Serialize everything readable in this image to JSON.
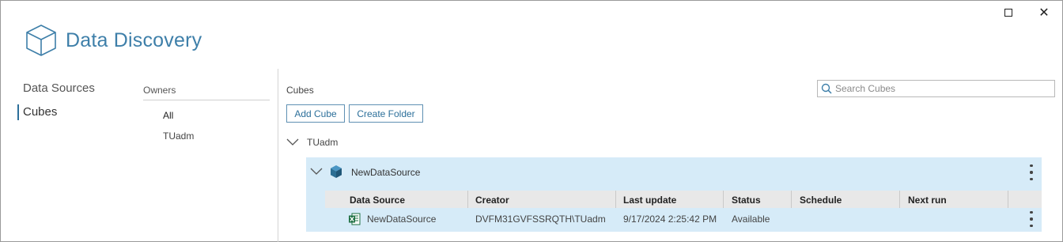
{
  "window": {
    "title": "Data Discovery",
    "controls": {
      "maximize": "maximize-icon",
      "close": "close-icon",
      "close_glyph": "✕"
    }
  },
  "nav": {
    "items": [
      {
        "label": "Data Sources",
        "selected": false
      },
      {
        "label": "Cubes",
        "selected": true
      }
    ]
  },
  "owners": {
    "title": "Owners",
    "items": [
      {
        "label": "All",
        "selected": true
      },
      {
        "label": "TUadm",
        "selected": false
      }
    ]
  },
  "cubes": {
    "title": "Cubes",
    "search_placeholder": "Search Cubes",
    "toolbar": {
      "add_label": "Add Cube",
      "folder_label": "Create Folder"
    },
    "folder": {
      "label": "TUadm",
      "expanded": true,
      "data_sources": [
        {
          "name": "NewDataSource",
          "expanded": true,
          "columns": [
            "Data Source",
            "Creator",
            "Last update",
            "Status",
            "Schedule",
            "Next run"
          ],
          "rows": [
            {
              "data_source": "NewDataSource",
              "creator": "DVFM31GVFSSRQTH\\TUadm",
              "last_update": "9/17/2024 2:25:42 PM",
              "status": "Available",
              "schedule": "",
              "next_run": ""
            }
          ]
        }
      ]
    }
  },
  "colors": {
    "accent": "#3e7fa9",
    "selection_panel": "#d6ebf8",
    "grid_header": "#e8e8e8",
    "excel_green": "#1d6f42",
    "cube_icon": "#2b6e93"
  }
}
